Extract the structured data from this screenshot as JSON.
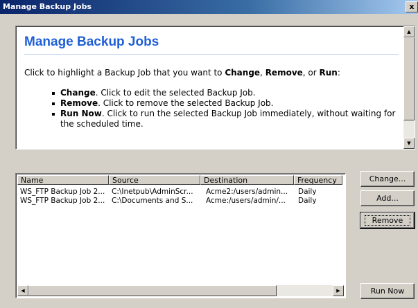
{
  "window": {
    "title": "Manage Backup Jobs",
    "close_label": "x"
  },
  "info": {
    "heading": "Manage Backup Jobs",
    "intro_prefix": "Click to highlight a Backup Job that you want to ",
    "intro_change": "Change",
    "intro_sep1": ", ",
    "intro_remove": "Remove",
    "intro_sep2": ", or ",
    "intro_run": "Run",
    "intro_suffix": ":",
    "bullets": [
      {
        "term": "Change",
        "text": ". Click to edit the selected Backup Job."
      },
      {
        "term": "Remove",
        "text": ". Click to remove the selected Backup Job."
      },
      {
        "term": "Run Now",
        "text": ". Click to run the selected Backup Job immediately, without waiting for the scheduled time."
      }
    ]
  },
  "jobs": {
    "columns": [
      "Name",
      "Source",
      "Destination",
      "Frequency"
    ],
    "rows": [
      {
        "name": "WS_FTP Backup Job 2...",
        "source": "C:\\Inetpub\\AdminScr...",
        "destination": "Acme2:/users/admin...",
        "frequency": "Daily"
      },
      {
        "name": "WS_FTP Backup Job 2...",
        "source": "C:\\Documents and S...",
        "destination": "Acme:/users/admin/...",
        "frequency": "Daily"
      }
    ]
  },
  "buttons": {
    "change": "Change...",
    "add": "Add...",
    "remove": "Remove",
    "run_now": "Run Now"
  },
  "icons": {
    "scroll_up": "▲",
    "scroll_down": "▼",
    "scroll_left": "◀",
    "scroll_right": "▶"
  }
}
